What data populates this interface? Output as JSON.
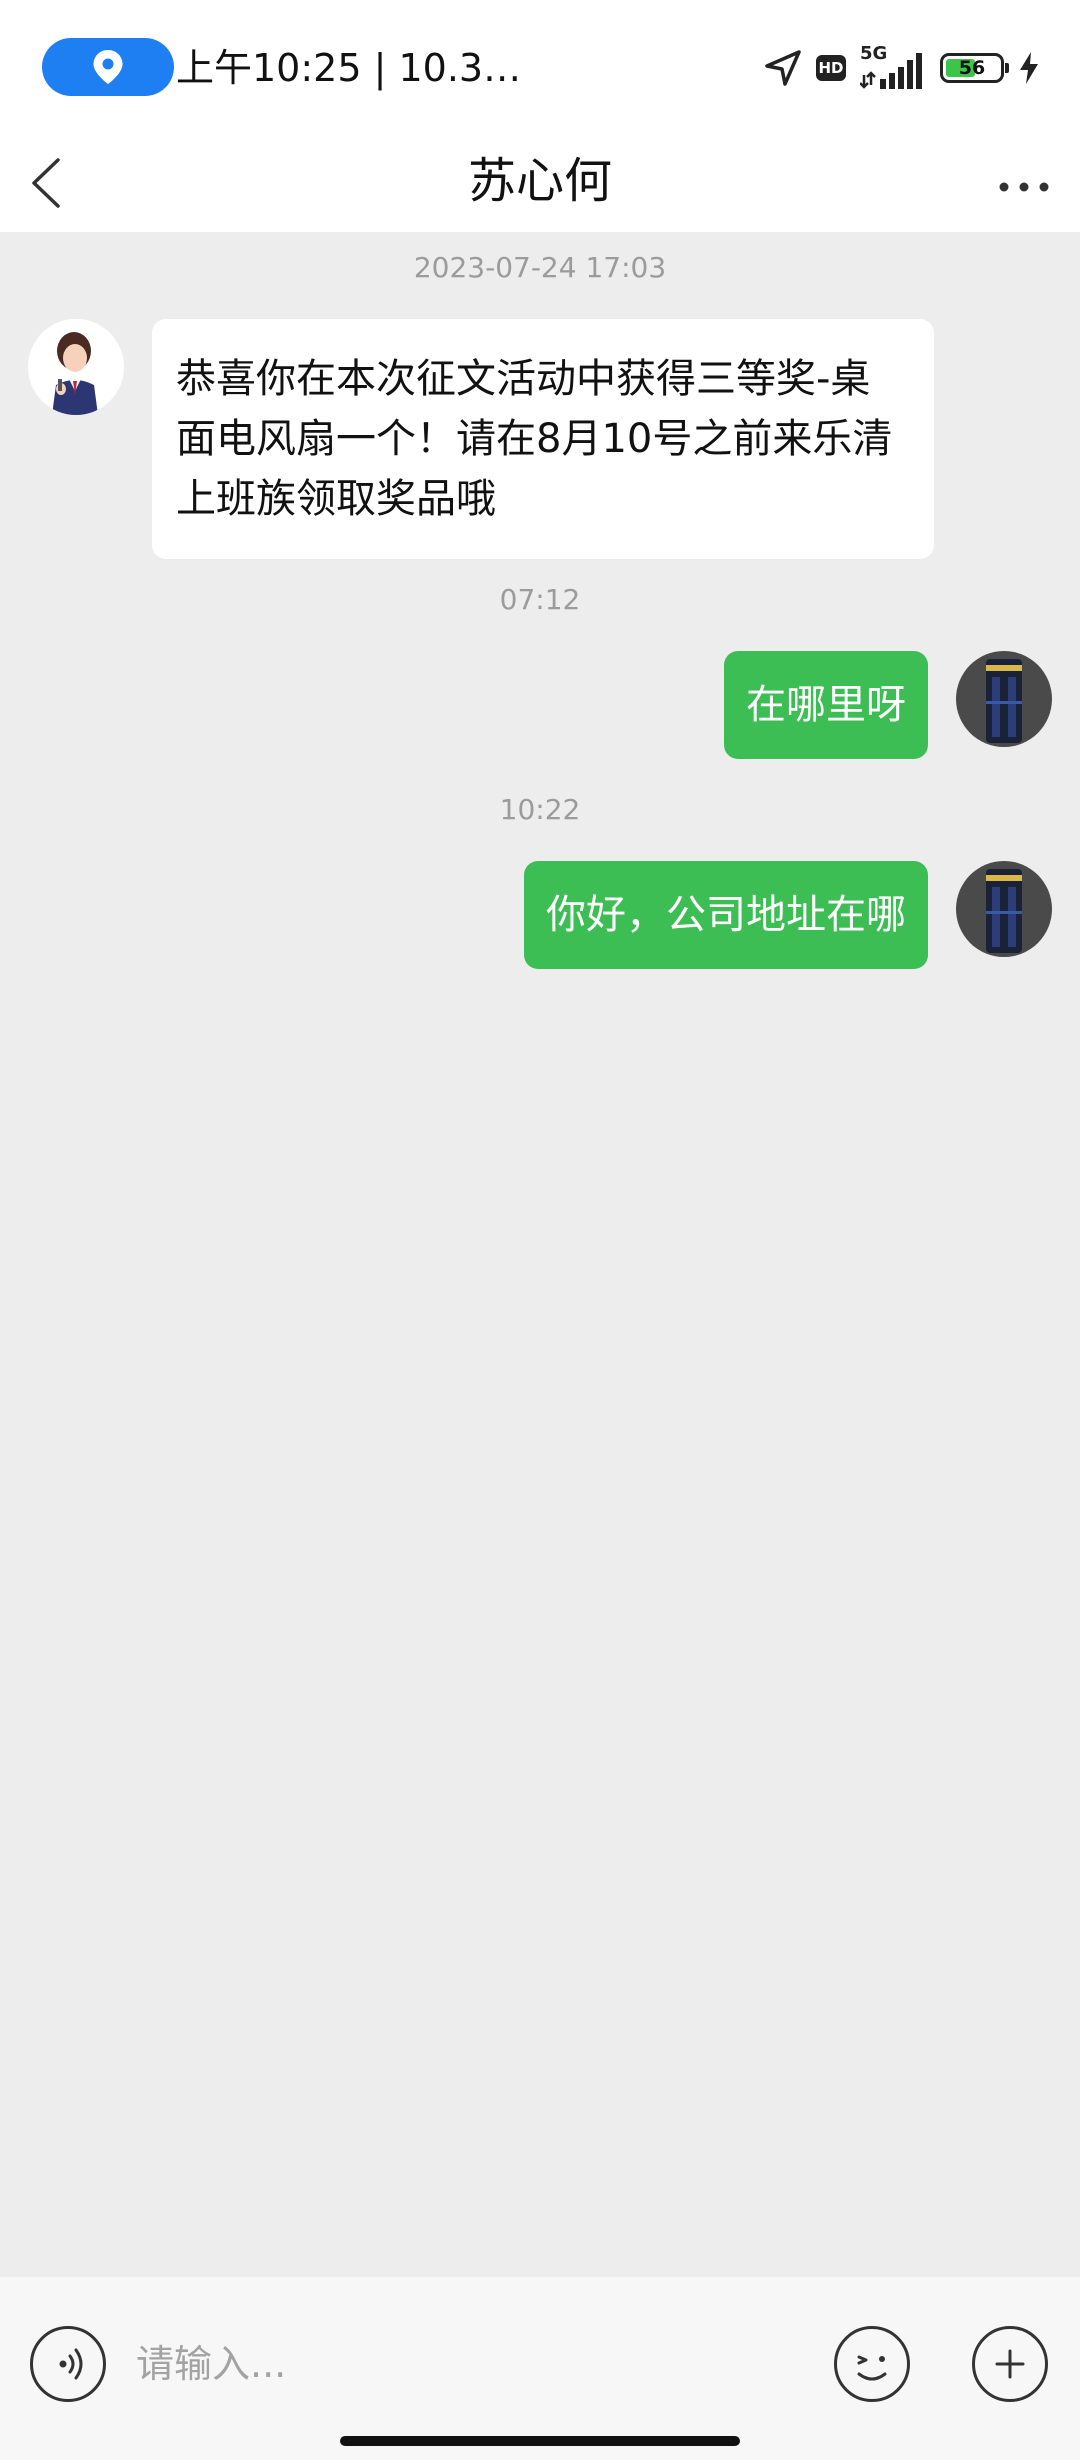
{
  "status_bar": {
    "time": "上午10:25 | 10.3…",
    "network": "5G",
    "hd": "HD",
    "battery": "56",
    "battery_level": 0.56
  },
  "header": {
    "title": "苏心何"
  },
  "chat": {
    "messages": [
      {
        "type": "timestamp",
        "text": "2023-07-24 17:03"
      },
      {
        "type": "incoming",
        "text": "恭喜你在本次征文活动中获得三等奖-桌面电风扇一个！请在8月10号之前来乐清上班族领取奖品哦"
      },
      {
        "type": "timestamp",
        "text": "07:12"
      },
      {
        "type": "outgoing",
        "text": "在哪里呀"
      },
      {
        "type": "timestamp",
        "text": "10:22"
      },
      {
        "type": "outgoing",
        "text": "你好，公司地址在哪"
      }
    ]
  },
  "input_bar": {
    "placeholder": "请输入..."
  },
  "colors": {
    "outgoing_bubble": "#3dbe54",
    "incoming_bubble": "#ffffff",
    "chat_background": "#ededed",
    "location_pill": "#1e7ff2"
  }
}
